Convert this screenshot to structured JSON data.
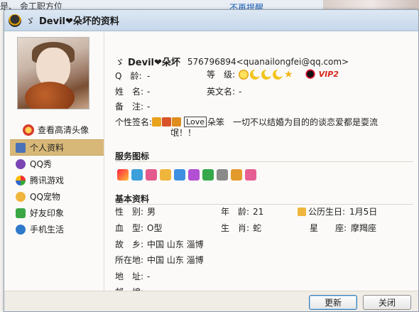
{
  "background": {
    "left_text": "是、   会工职方位   ",
    "link_text": "不再提醒"
  },
  "window": {
    "title_sig": "ゞ",
    "title": "Devil❤朵坏的资料"
  },
  "sidebar": {
    "hd_link": "查看高清头像",
    "items": [
      {
        "label": "个人资料",
        "icon": "profile-icon",
        "active": true
      },
      {
        "label": "QQ秀",
        "icon": "qqshow-icon"
      },
      {
        "label": "腾讯游戏",
        "icon": "game-icon"
      },
      {
        "label": "QQ宠物",
        "icon": "pet-icon"
      },
      {
        "label": "好友印象",
        "icon": "friend-impression-icon"
      },
      {
        "label": "手机生活",
        "icon": "mobile-life-icon"
      }
    ]
  },
  "profile": {
    "sig_prefix": "ゞ",
    "nickname": "Devil❤朵坏",
    "qq_email": "576796894<quanailongfei@qq.com>",
    "age_label": "Q　龄:",
    "age_value": "-",
    "level_label": "等　级:",
    "vip_label": "VIP2",
    "name_label": "姓　名:",
    "name_value": "-",
    "en_name_label": "英文名:",
    "en_name_value": "-",
    "remark_label": "备　注:",
    "remark_value": "-",
    "signature_label": "个性签名:",
    "signature_love": "Love",
    "signature_text_1": "朵笨　一切不以结婚为目的的谈恋爱都是耍流",
    "signature_text_2": "氓！！"
  },
  "services": {
    "title": "服务图标"
  },
  "basic": {
    "title": "基本资料",
    "gender_label": "性　别:",
    "gender_value": "男",
    "age2_label": "年　龄:",
    "age2_value": "21",
    "birthday_label": "公历生日:",
    "birthday_value": "1月5日",
    "blood_label": "血　型:",
    "blood_value": "O型",
    "zodiac_label": "生　肖:",
    "zodiac_value": "蛇",
    "star_label": "星　　座:",
    "star_value": "摩羯座",
    "hometown_label": "故　乡:",
    "hometown_value": "中国 山东 淄博",
    "location_label": "所在地:",
    "location_value": "中国 山东 淄博",
    "address_label": "地　址:",
    "address_value": "-",
    "postcode_label": "邮　编:",
    "postcode_value": "-"
  },
  "buttons": {
    "update": "更新",
    "close": "关闭"
  },
  "colors": {
    "accent_nav": "#d8b878",
    "vip_red": "#d8261a",
    "title_bar": "#c6d7ea"
  }
}
